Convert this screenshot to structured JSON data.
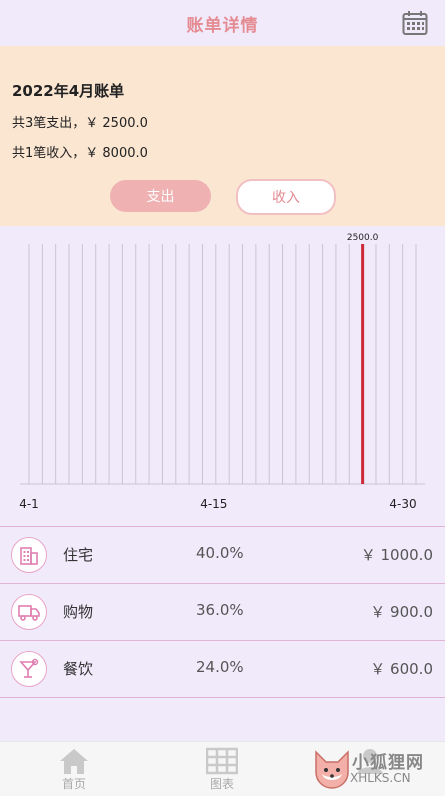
{
  "header": {
    "title": "账单详情",
    "calendar_icon": "calendar-icon"
  },
  "summary": {
    "month_title": "2022年4月账单",
    "expense_line": "共3笔支出，￥ 2500.0",
    "income_line": "共1笔收入，￥ 8000.0",
    "expense_button": "支出",
    "income_button": "收入"
  },
  "chart_data": {
    "type": "bar",
    "x_tick_labels": [
      "4-1",
      "4-15",
      "4-30"
    ],
    "days": [
      1,
      2,
      3,
      4,
      5,
      6,
      7,
      8,
      9,
      10,
      11,
      12,
      13,
      14,
      15,
      16,
      17,
      18,
      19,
      20,
      21,
      22,
      23,
      24,
      25,
      26,
      27,
      28,
      29,
      30
    ],
    "values": [
      0,
      0,
      0,
      0,
      0,
      0,
      0,
      0,
      0,
      0,
      0,
      0,
      0,
      0,
      0,
      0,
      0,
      0,
      0,
      0,
      0,
      0,
      0,
      0,
      0,
      2500.0,
      0,
      0,
      0,
      0
    ],
    "highlight_label": "2500.0",
    "highlight_day": 26,
    "bar_color": "#cc2a36",
    "grid_color": "#c9c4d4"
  },
  "categories": [
    {
      "name": "住宅",
      "percent": "40.0%",
      "amount": "￥ 1000.0",
      "icon": "building-icon"
    },
    {
      "name": "购物",
      "percent": "36.0%",
      "amount": "￥ 900.0",
      "icon": "truck-icon"
    },
    {
      "name": "餐饮",
      "percent": "24.0%",
      "amount": "￥ 600.0",
      "icon": "cocktail-icon"
    }
  ],
  "tabbar": {
    "tabs": [
      {
        "label": "首页",
        "icon": "home-icon"
      },
      {
        "label": "图表",
        "icon": "table-icon"
      },
      {
        "label": "",
        "icon": "profile-icon"
      }
    ]
  },
  "watermark": {
    "line1": "小狐狸网",
    "line2": "XHLKS.CN"
  },
  "colors": {
    "accent": "#e58c93",
    "background": "#f1eafb",
    "summary_bg": "#fbe6d2"
  }
}
